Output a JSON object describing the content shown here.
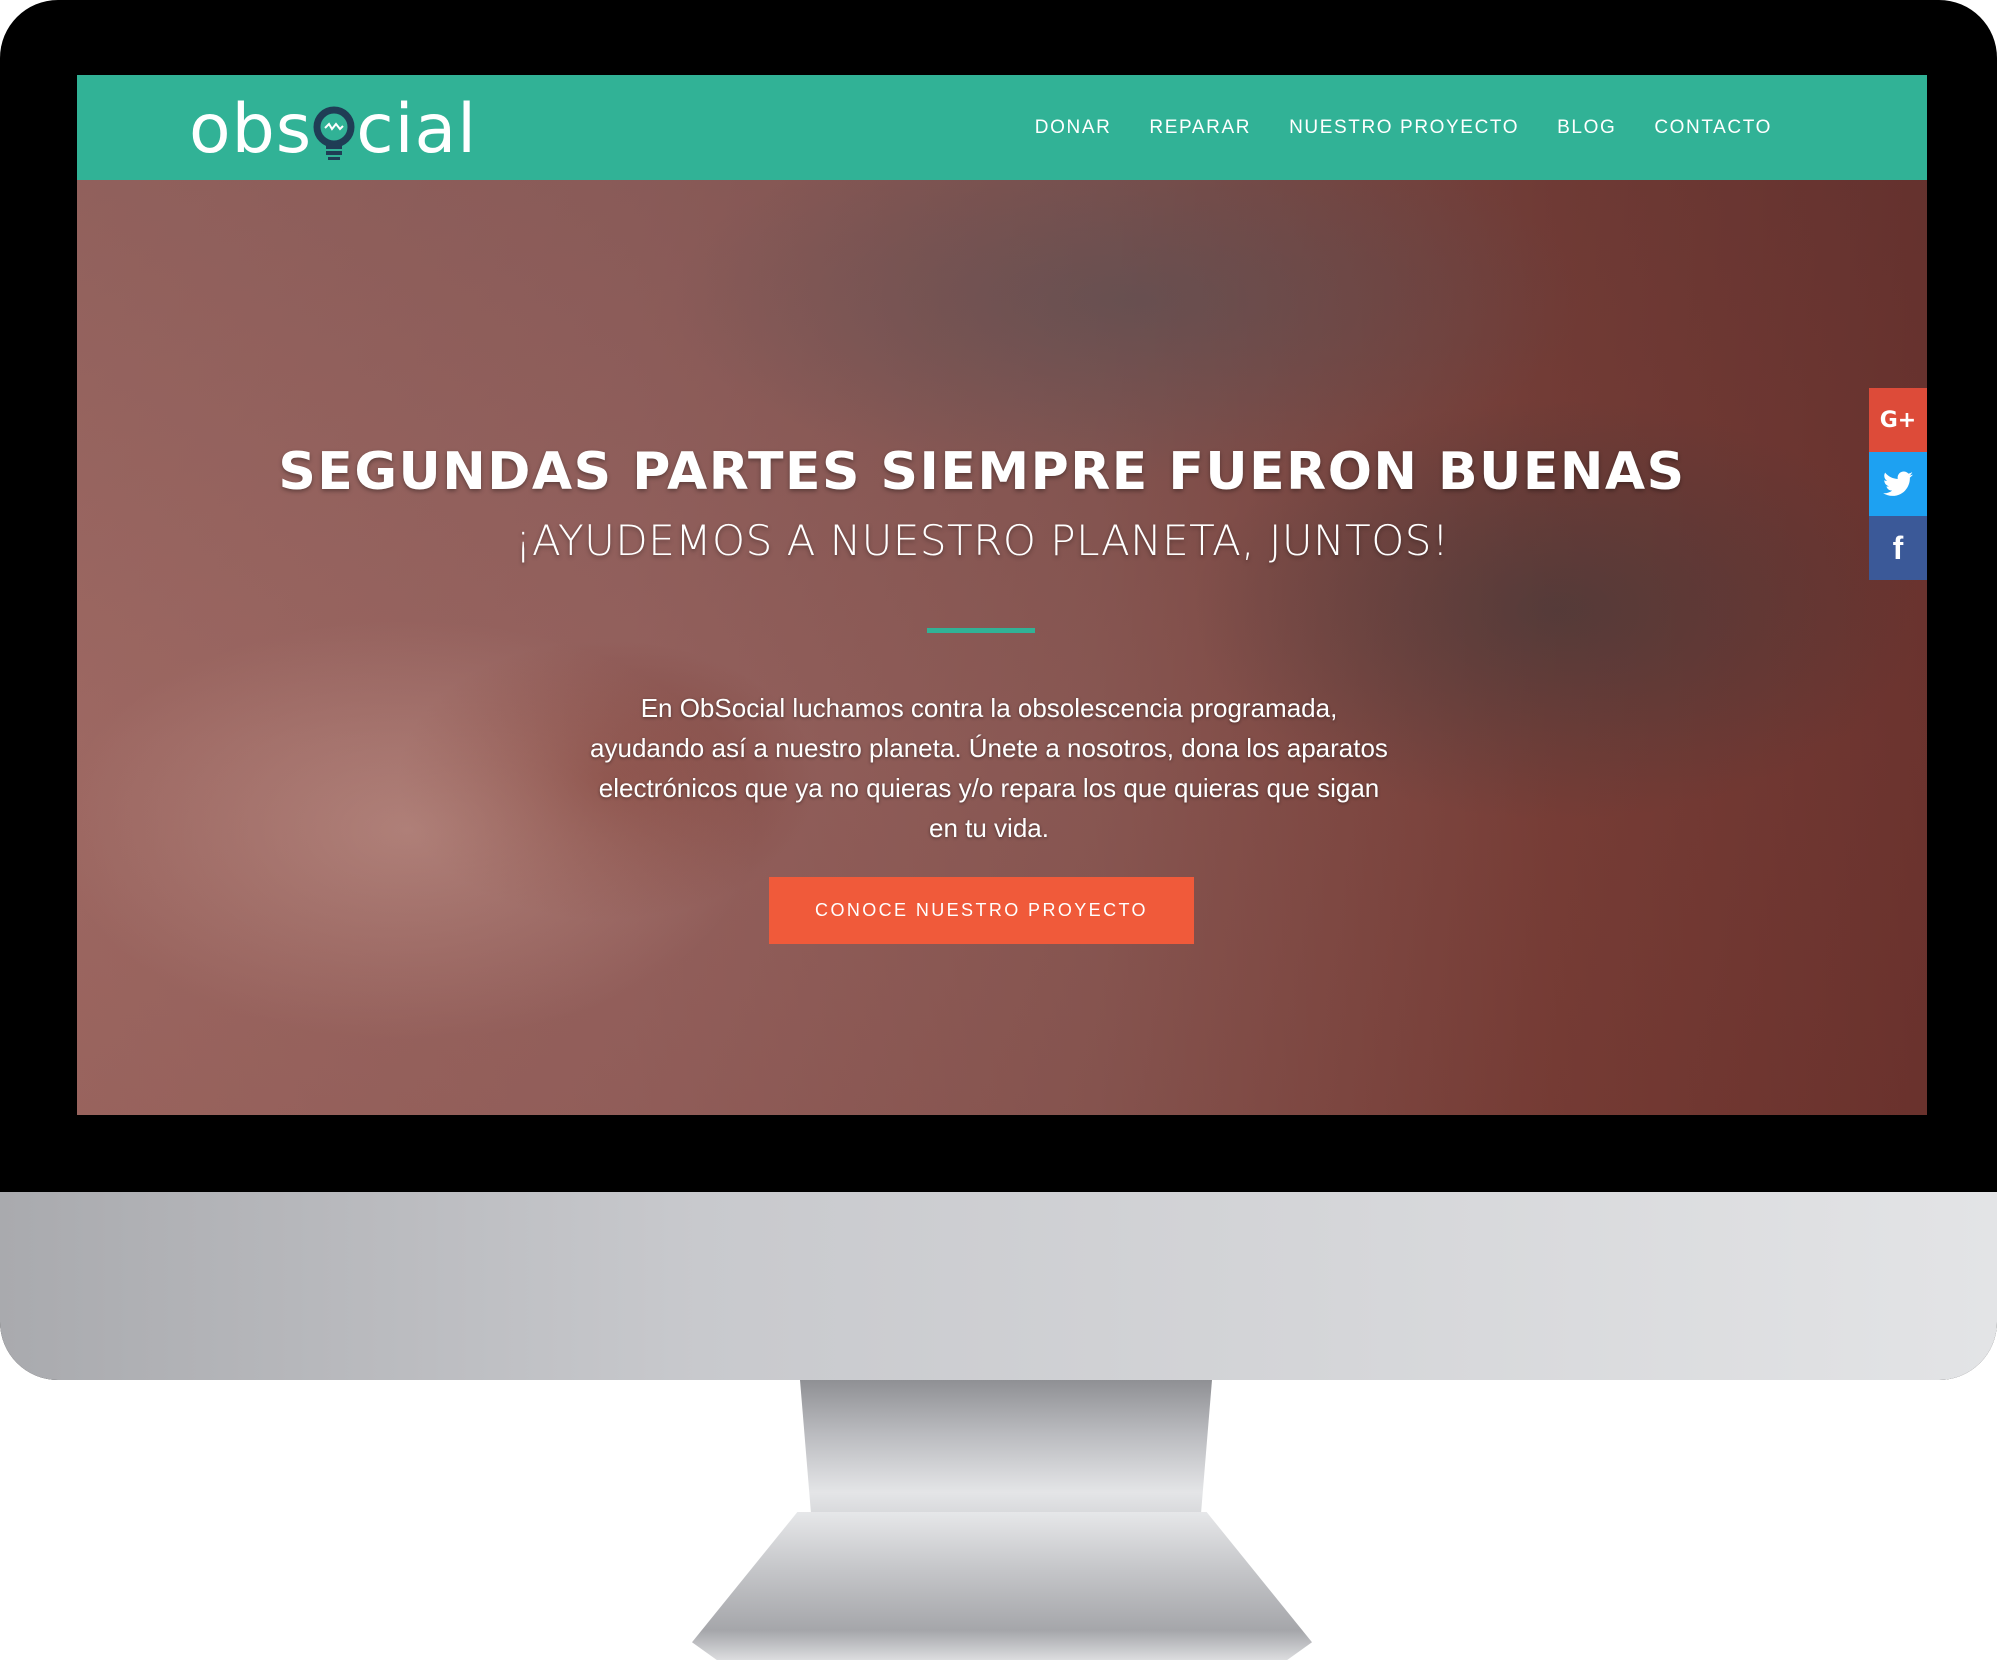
{
  "brand": {
    "logo_text_left": "obs",
    "logo_text_right": "cial",
    "accent": "#31b296",
    "cta_color": "#f05a3a"
  },
  "nav": {
    "items": [
      {
        "label": "DONAR"
      },
      {
        "label": "REPARAR"
      },
      {
        "label": "NUESTRO PROYECTO"
      },
      {
        "label": "BLOG"
      },
      {
        "label": "CONTACTO"
      }
    ]
  },
  "hero": {
    "title": "SEGUNDAS PARTES SIEMPRE FUERON BUENAS",
    "subtitle": "¡AYUDEMOS A NUESTRO PLANETA, JUNTOS!",
    "body": "En ObSocial luchamos contra la obsolescencia programada, ayudando así a nuestro planeta. Únete a nosotros, dona los aparatos electrónicos que ya no quieras y/o repara los que quieras que sigan en tu vida.",
    "cta_label": "CONOCE NUESTRO PROYECTO"
  },
  "share": {
    "items": [
      {
        "icon": "google-plus-icon",
        "glyph": "G+",
        "color": "#dd4b39"
      },
      {
        "icon": "twitter-icon",
        "glyph": "",
        "color": "#1da1f2"
      },
      {
        "icon": "facebook-icon",
        "glyph": "f",
        "color": "#3b5998"
      }
    ]
  }
}
